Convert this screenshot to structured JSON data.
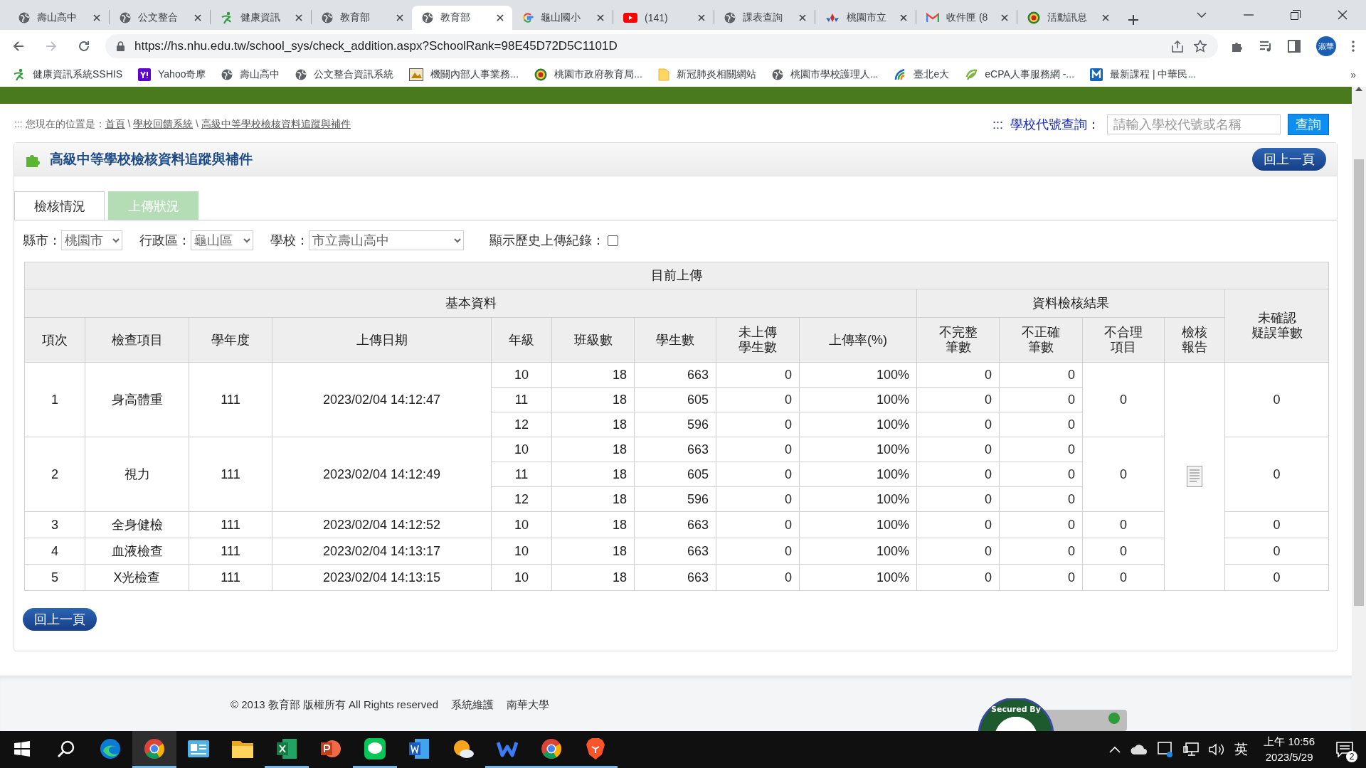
{
  "browser": {
    "tabs": [
      {
        "title": "壽山高中",
        "kind": "globe",
        "selected": false
      },
      {
        "title": "公文整合",
        "kind": "globe",
        "selected": false
      },
      {
        "title": "健康資訊",
        "kind": "sprout",
        "selected": false
      },
      {
        "title": "教育部",
        "kind": "globe",
        "selected": false
      },
      {
        "title": "教育部",
        "kind": "globe",
        "selected": true
      },
      {
        "title": "龜山國小",
        "kind": "google",
        "selected": false
      },
      {
        "title": "(141)",
        "kind": "video",
        "selected": false
      },
      {
        "title": "課表查詢",
        "kind": "globe",
        "selected": false
      },
      {
        "title": "桃園市立",
        "kind": "flower",
        "selected": false
      },
      {
        "title": "收件匣 (8",
        "kind": "mail",
        "selected": false
      },
      {
        "title": "活動訊息",
        "kind": "emblem",
        "selected": false
      }
    ],
    "url": "https://hs.nhu.edu.tw/school_sys/check_addition.aspx?SchoolRank=98E45D72D5C1101D",
    "profile": "淑華",
    "bookmarks": [
      {
        "label": "健康資訊系統SSHIS",
        "kind": "sprout"
      },
      {
        "label": "Yahoo奇摩",
        "kind": "yahoo"
      },
      {
        "label": "壽山高中",
        "kind": "globe"
      },
      {
        "label": "公文整合資訊系統",
        "kind": "globe"
      },
      {
        "label": "機關內部人事業務...",
        "kind": "picture"
      },
      {
        "label": "桃園市政府教育局...",
        "kind": "emblem"
      },
      {
        "label": "新冠肺炎相關網站",
        "kind": "folder"
      },
      {
        "label": "桃園市學校護理人...",
        "kind": "globe"
      },
      {
        "label": "臺北e大",
        "kind": "swoosh"
      },
      {
        "label": "eCPA人事服務網 -...",
        "kind": "leaf"
      },
      {
        "label": "最新課程 | 中華民...",
        "kind": "m"
      }
    ],
    "more": "»"
  },
  "page": {
    "breadcrumb": {
      "prefix": "::: 您現在的位置是：",
      "separator": "\\",
      "links": [
        "首頁",
        "學校回饋系統",
        "高級中等學校檢核資料追蹤與補件"
      ]
    },
    "search": {
      "label": ":::  學校代號查詢：",
      "placeholder": "請輸入學校代號或名稱",
      "button": "查詢"
    },
    "title": "高級中等學校檢核資料追蹤與補件",
    "back_button": "回上一頁",
    "tabs": [
      {
        "label": "檢核情況",
        "selected": true
      },
      {
        "label": "上傳狀況",
        "selected": false
      }
    ],
    "filters": {
      "city_label": "縣市：",
      "city": "桃園市",
      "district_label": "行政區：",
      "district": "龜山區",
      "school_label": "學校：",
      "school": "市立壽山高中",
      "history_label": "顯示歷史上傳紀錄：",
      "history_checked": false
    },
    "table": {
      "title": "目前上傳",
      "groups": [
        {
          "label": "基本資料",
          "columns": [
            [
              "項次"
            ],
            [
              "檢查項目"
            ],
            [
              "學年度"
            ],
            [
              "上傳日期"
            ],
            [
              "年級"
            ],
            [
              "班級數"
            ],
            [
              "學生數"
            ],
            [
              "未上傳",
              "學生數"
            ],
            [
              "上傳率(%)"
            ]
          ]
        },
        {
          "label": "資料檢核結果",
          "columns": [
            [
              "不完整",
              "筆數"
            ],
            [
              "不正確",
              "筆數"
            ],
            [
              "不合理",
              "項目"
            ],
            [
              "檢核",
              "報告"
            ]
          ]
        }
      ],
      "last_column": [
        "未確認",
        "疑誤筆數"
      ],
      "records": [
        {
          "index": "1",
          "item": "身高體重",
          "year": "111",
          "date": "2023/02/04 14:12:47",
          "grades": [
            {
              "grade": "10",
              "classes": "18",
              "students": "663",
              "not_uploaded": "0",
              "rate": "100%",
              "incomplete": "0",
              "incorrect": "0"
            },
            {
              "grade": "11",
              "classes": "18",
              "students": "605",
              "not_uploaded": "0",
              "rate": "100%",
              "incomplete": "0",
              "incorrect": "0"
            },
            {
              "grade": "12",
              "classes": "18",
              "students": "596",
              "not_uploaded": "0",
              "rate": "100%",
              "incomplete": "0",
              "incorrect": "0"
            }
          ],
          "unreasonable": "0",
          "unconfirmed": "0"
        },
        {
          "index": "2",
          "item": "視力",
          "year": "111",
          "date": "2023/02/04 14:12:49",
          "grades": [
            {
              "grade": "10",
              "classes": "18",
              "students": "663",
              "not_uploaded": "0",
              "rate": "100%",
              "incomplete": "0",
              "incorrect": "0"
            },
            {
              "grade": "11",
              "classes": "18",
              "students": "605",
              "not_uploaded": "0",
              "rate": "100%",
              "incomplete": "0",
              "incorrect": "0"
            },
            {
              "grade": "12",
              "classes": "18",
              "students": "596",
              "not_uploaded": "0",
              "rate": "100%",
              "incomplete": "0",
              "incorrect": "0"
            }
          ],
          "unreasonable": "0",
          "unconfirmed": "0"
        },
        {
          "index": "3",
          "item": "全身健檢",
          "year": "111",
          "date": "2023/02/04 14:12:52",
          "grades": [
            {
              "grade": "10",
              "classes": "18",
              "students": "663",
              "not_uploaded": "0",
              "rate": "100%",
              "incomplete": "0",
              "incorrect": "0"
            }
          ],
          "unreasonable": "0",
          "unconfirmed": "0"
        },
        {
          "index": "4",
          "item": "血液檢查",
          "year": "111",
          "date": "2023/02/04 14:13:17",
          "grades": [
            {
              "grade": "10",
              "classes": "18",
              "students": "663",
              "not_uploaded": "0",
              "rate": "100%",
              "incomplete": "0",
              "incorrect": "0"
            }
          ],
          "unreasonable": "0",
          "unconfirmed": "0"
        },
        {
          "index": "5",
          "item": "X光檢查",
          "year": "111",
          "date": "2023/02/04 14:13:15",
          "grades": [
            {
              "grade": "10",
              "classes": "18",
              "students": "663",
              "not_uploaded": "0",
              "rate": "100%",
              "incomplete": "0",
              "incorrect": "0"
            }
          ],
          "unreasonable": "0",
          "unconfirmed": "0"
        }
      ]
    },
    "bottom_back_button": "回上一頁",
    "footer": {
      "copyright": "© 2013 教育部 版權所有 All Rights reserved",
      "maintenance": "系統維護",
      "maintainer": "南華大學",
      "seal": "Secured By"
    }
  },
  "taskbar": {
    "apps": [
      {
        "kind": "edge",
        "running": false,
        "active": false
      },
      {
        "kind": "chrome",
        "running": true,
        "active": true
      },
      {
        "kind": "card",
        "running": false,
        "active": false
      },
      {
        "kind": "folder",
        "running": false,
        "active": false
      },
      {
        "kind": "excel",
        "running": true,
        "active": false
      },
      {
        "kind": "powerpoint",
        "running": false,
        "active": false
      },
      {
        "kind": "chat",
        "running": true,
        "active": false
      },
      {
        "kind": "word",
        "running": false,
        "active": false
      },
      {
        "kind": "weather",
        "running": false,
        "active": false
      },
      {
        "kind": "meeting",
        "running": true,
        "active": false
      },
      {
        "kind": "chrome",
        "running": true,
        "active": false
      },
      {
        "kind": "lion",
        "running": true,
        "active": false
      }
    ],
    "ime": "英",
    "time": "上午 10:56",
    "date": "2023/5/29",
    "notifications": "2"
  }
}
